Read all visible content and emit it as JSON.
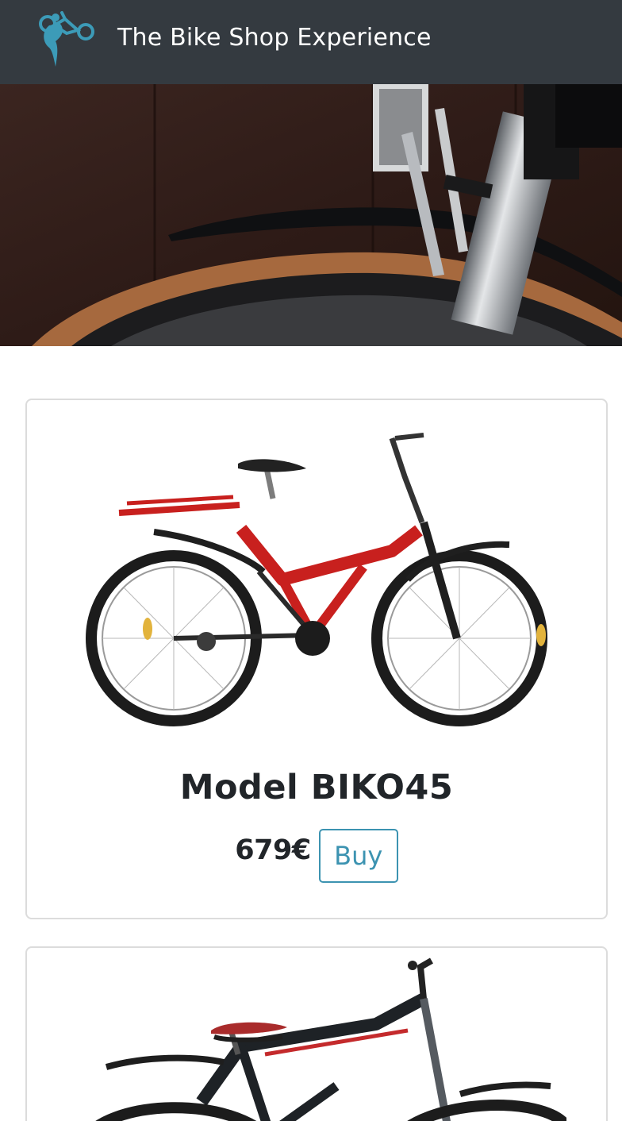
{
  "header": {
    "title": "The Bike Shop Experience",
    "logo_icon": "cyclist-logo-icon",
    "background": "#343a40",
    "logo_color": "#3c9bb8"
  },
  "hero": {
    "image": "bike-front-wheel-photo"
  },
  "products": [
    {
      "name": "Model BIKO45",
      "price": "679€",
      "buy_label": "Buy",
      "image": "red-mountain-bike-image"
    },
    {
      "image": "black-red-mountain-bike-image"
    }
  ],
  "colors": {
    "accent": "#3c93b1",
    "card_border": "#dcdcdc"
  }
}
